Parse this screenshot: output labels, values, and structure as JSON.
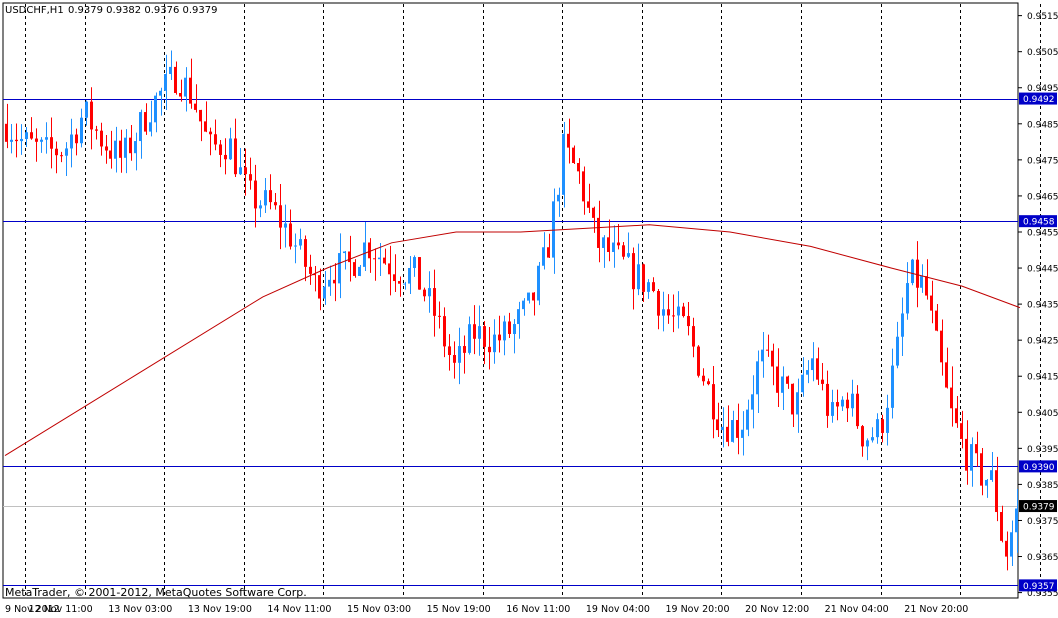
{
  "chart_data": {
    "type": "candlestick",
    "symbol_label": "USDCHF,H1",
    "ohlc_label": "0.9379 0.9382 0.9376 0.9379",
    "copyright": "MetaTrader, © 2001-2012, MetaQuotes Software Corp.",
    "ylim": [
      0.93535,
      0.95185
    ],
    "y_ticks": [
      "0.9515",
      "0.9505",
      "0.9495",
      "0.9485",
      "0.9475",
      "0.9465",
      "0.9455",
      "0.9445",
      "0.9435",
      "0.9425",
      "0.9415",
      "0.9405",
      "0.9395",
      "0.9385",
      "0.9375",
      "0.9365",
      "0.9355"
    ],
    "x_tick_labels": [
      "9 Nov 2012",
      "12 Nov 11:00",
      "13 Nov 03:00",
      "13 Nov 19:00",
      "14 Nov 11:00",
      "15 Nov 03:00",
      "15 Nov 19:00",
      "16 Nov 11:00",
      "19 Nov 04:00",
      "19 Nov 20:00",
      "20 Nov 12:00",
      "21 Nov 04:00",
      "21 Nov 20:00"
    ],
    "horizontal_levels": [
      {
        "value": 0.9492,
        "label": "0.9492"
      },
      {
        "value": 0.9458,
        "label": "0.9458"
      },
      {
        "value": 0.939,
        "label": "0.9390"
      },
      {
        "value": 0.9357,
        "label": "0.9357"
      }
    ],
    "current_price": {
      "value": 0.9379,
      "label": "0.9379"
    },
    "bar_count": 204,
    "moving_average": [
      [
        0,
        0.9393
      ],
      [
        40,
        0.9415
      ],
      [
        80,
        0.9437
      ],
      [
        100,
        0.9445
      ],
      [
        120,
        0.9452
      ],
      [
        140,
        0.9455
      ],
      [
        160,
        0.9455
      ],
      [
        180,
        0.9456
      ],
      [
        200,
        0.9457
      ],
      [
        225,
        0.9455
      ],
      [
        250,
        0.9451
      ],
      [
        275,
        0.9445
      ],
      [
        297,
        0.944
      ],
      [
        315,
        0.9434
      ]
    ],
    "candle_anchors": [
      [
        0,
        0.9485
      ],
      [
        5,
        0.948
      ],
      [
        12,
        0.9477
      ],
      [
        18,
        0.9478
      ],
      [
        24,
        0.9488
      ],
      [
        30,
        0.948
      ],
      [
        36,
        0.9475
      ],
      [
        45,
        0.949
      ],
      [
        53,
        0.9499
      ],
      [
        58,
        0.9492
      ],
      [
        63,
        0.9478
      ],
      [
        69,
        0.948
      ],
      [
        75,
        0.9465
      ],
      [
        82,
        0.9462
      ],
      [
        88,
        0.9454
      ],
      [
        96,
        0.944
      ],
      [
        101,
        0.9445
      ],
      [
        106,
        0.9445
      ],
      [
        112,
        0.9452
      ],
      [
        120,
        0.9445
      ],
      [
        127,
        0.9443
      ],
      [
        133,
        0.9432
      ],
      [
        139,
        0.9417
      ],
      [
        145,
        0.9427
      ],
      [
        152,
        0.9425
      ],
      [
        157,
        0.9428
      ],
      [
        163,
        0.9435
      ],
      [
        168,
        0.945
      ],
      [
        173,
        0.9478
      ],
      [
        178,
        0.947
      ],
      [
        183,
        0.9452
      ],
      [
        189,
        0.9448
      ],
      [
        195,
        0.9443
      ],
      [
        200,
        0.944
      ],
      [
        205,
        0.9432
      ],
      [
        211,
        0.9428
      ],
      [
        217,
        0.9413
      ],
      [
        222,
        0.9402
      ],
      [
        228,
        0.9401
      ],
      [
        234,
        0.942
      ],
      [
        240,
        0.9413
      ],
      [
        245,
        0.9406
      ],
      [
        250,
        0.942
      ],
      [
        256,
        0.9403
      ],
      [
        261,
        0.941
      ],
      [
        266,
        0.9398
      ],
      [
        271,
        0.94
      ],
      [
        276,
        0.942
      ],
      [
        280,
        0.9443
      ],
      [
        285,
        0.944
      ],
      [
        289,
        0.9422
      ],
      [
        293,
        0.9405
      ],
      [
        297,
        0.9395
      ],
      [
        302,
        0.9388
      ],
      [
        306,
        0.9386
      ],
      [
        310,
        0.9365
      ],
      [
        314,
        0.9379
      ]
    ]
  }
}
